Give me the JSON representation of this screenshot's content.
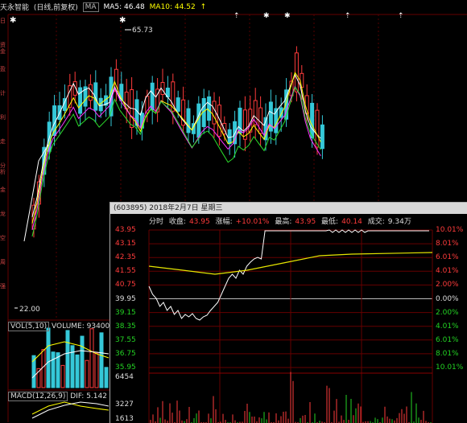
{
  "main": {
    "stock_name": "天永智能",
    "period": "(日线,前复权)",
    "ma_button": "MA",
    "ma5": "MA5: 46.48",
    "ma10": "MA10: 44.52",
    "ma10_arrow": "↑",
    "high_label": "65.73",
    "low_label": "22.00",
    "rail_labels": [
      "日",
      "资金",
      "盈",
      "计",
      "利",
      "走",
      "分析",
      "金",
      "龙",
      "空",
      "周",
      "强"
    ]
  },
  "volume": {
    "label": "VOL(5,10)",
    "value_label": "VOLUME: 93400"
  },
  "macd": {
    "label": "MACD(12,26,9)",
    "dif": "DIF: 5.142"
  },
  "intraday": {
    "title": "(603895) 2018年2月7日 星期三",
    "tab": "分时",
    "close_label": "收盘:",
    "close_value": "43.95",
    "change_label": "涨幅:",
    "change_value": "+10.01%",
    "high_label": "最高:",
    "high_value": "43.95",
    "low_label": "最低:",
    "low_value": "40.14",
    "turnover_label": "成交:",
    "turnover_value": "9.34万",
    "price_ticks": [
      "43.95",
      "43.15",
      "42.35",
      "41.55",
      "40.75",
      "39.95",
      "39.15",
      "38.35",
      "37.55",
      "36.75",
      "35.95"
    ],
    "pct_ticks": [
      "10.01%",
      "8.01%",
      "6.01%",
      "4.01%",
      "2.00%",
      "0.00%",
      "2.00%",
      "4.01%",
      "6.01%",
      "8.01%",
      "10.01%"
    ],
    "vol_ticks": [
      "6454",
      "3227",
      "1613"
    ]
  },
  "colors": {
    "up": "#ff3b3b",
    "down": "#23d323",
    "candle_up": "#ff3b3b",
    "candle_down": "#35c8d8",
    "ma5": "#ffffff",
    "ma10": "#ffff00"
  }
}
